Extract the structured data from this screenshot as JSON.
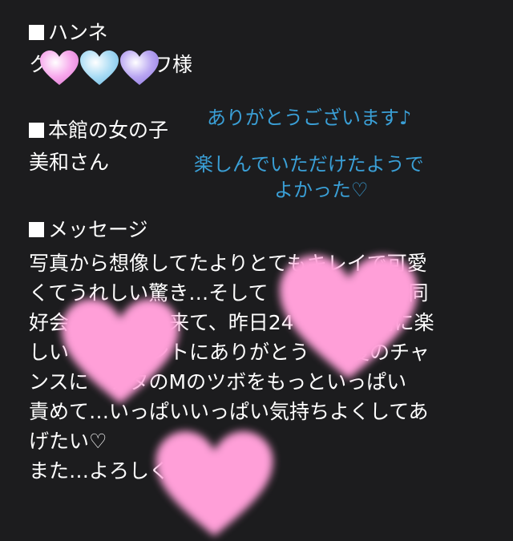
{
  "sections": {
    "handle": {
      "heading": "ハンネ",
      "name_first": "ク",
      "name_last": "ワ",
      "suffix": "様"
    },
    "girl": {
      "heading": "本館の女の子",
      "name": "美和さん"
    },
    "message": {
      "heading": "メッセージ",
      "body": "写真から想像してたよりとてもキレイで可愛\nくてうれしい驚き…そして　　　　　　イ同\n好会　　　　　来て、昨日24　　　　高に楽\nしい　　　　ントにありがとう　　度のチャ\nンスに　ナタのMのツボをもっといっぱい\n責めて…いっぱいいっぱい気持ちよくしてあ\nげたい♡\nまた…よろしく"
    }
  },
  "replies": {
    "reply1": "ありがとうございます♪",
    "reply2_line1": "楽しんでいただけたようで",
    "reply2_line2": "よかった♡"
  },
  "colors": {
    "background": "#1c1c1e",
    "text": "#ffffff",
    "reply": "#3a9fd6",
    "censor_pink": "#ff9fd8",
    "heart_pink": "#f7a8ec",
    "heart_blue": "#a9dcf5",
    "heart_purple": "#b9a6f2"
  }
}
